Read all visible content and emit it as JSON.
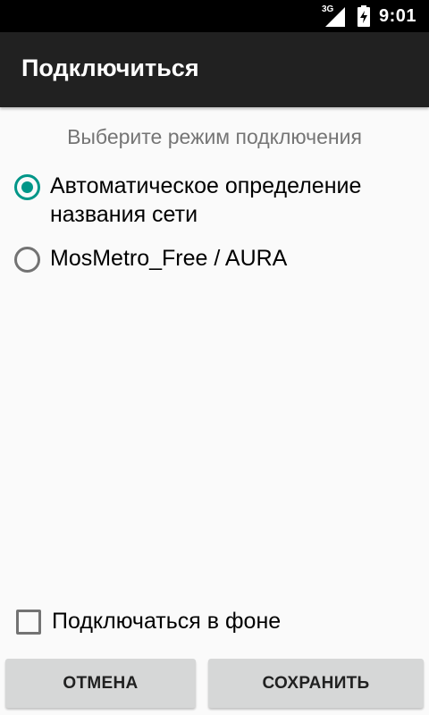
{
  "status_bar": {
    "network_type": "3G",
    "time": "9:01",
    "icons": [
      "signal-icon",
      "battery-charging-icon"
    ]
  },
  "app_bar": {
    "title": "Подключиться"
  },
  "dialog": {
    "prompt": "Выберите режим подключения",
    "options": [
      {
        "label": "Автоматическое определение названия сети",
        "checked": true
      },
      {
        "label": "MosMetro_Free / AURA",
        "checked": false
      }
    ],
    "background_checkbox": {
      "label": "Подключаться в фоне",
      "checked": false
    },
    "cancel_label": "ОТМЕНА",
    "save_label": "СОХРАНИТЬ"
  },
  "colors": {
    "accent": "#009688",
    "app_bar": "#212121",
    "status_bar": "#000000",
    "background": "#fafafa",
    "button": "#d6d7d7"
  }
}
